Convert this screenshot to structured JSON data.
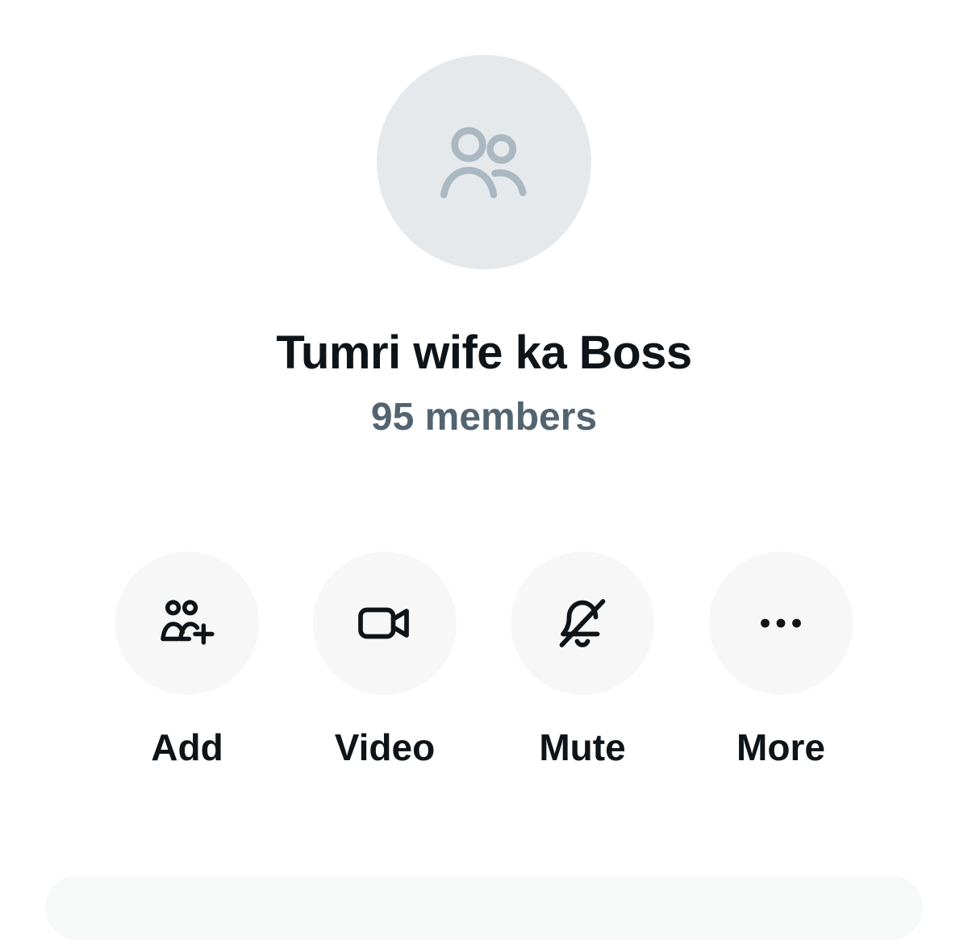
{
  "group": {
    "name": "Tumri wife ka Boss",
    "members": "95 members",
    "avatar_icon": "group-avatar-placeholder-icon"
  },
  "actions": [
    {
      "label": "Add",
      "icon": "add-people-icon"
    },
    {
      "label": "Video",
      "icon": "video-camera-icon"
    },
    {
      "label": "Mute",
      "icon": "bell-off-icon"
    },
    {
      "label": "More",
      "icon": "more-horizontal-icon"
    }
  ],
  "colors": {
    "text_primary": "#0f1419",
    "text_secondary": "#536471",
    "action_bg": "#f7f7f7",
    "avatar_placeholder": "#e6e9ec"
  }
}
